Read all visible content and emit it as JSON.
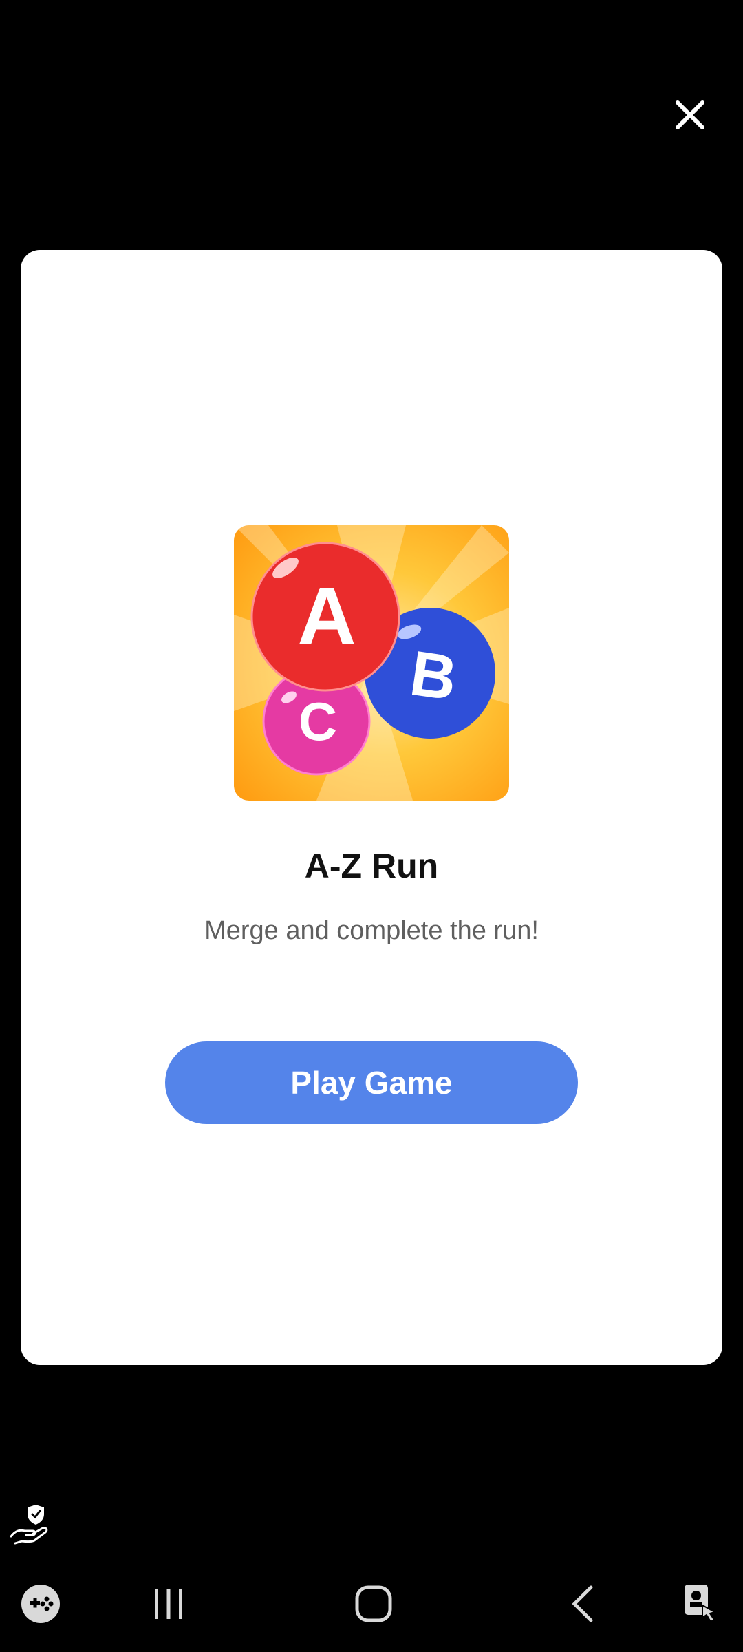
{
  "colors": {
    "backdrop": "#000000",
    "card": "#ffffff",
    "accent": "#5484ea",
    "title": "#111111",
    "subtitle": "#5f5f5f"
  },
  "dialog": {
    "close_icon": "close-icon",
    "game": {
      "icon": "abc-bubbles-icon",
      "icon_letters": [
        "A",
        "B",
        "C"
      ],
      "title": "A-Z Run",
      "subtitle": "Merge and complete the run!"
    },
    "play_button_label": "Play Game"
  },
  "system": {
    "privacy_icon": "privacy-hand-shield-icon",
    "navbar": {
      "items": [
        {
          "name": "game-launcher-icon"
        },
        {
          "name": "recent-apps-icon"
        },
        {
          "name": "home-icon"
        },
        {
          "name": "back-icon"
        },
        {
          "name": "accessibility-icon"
        }
      ]
    }
  }
}
